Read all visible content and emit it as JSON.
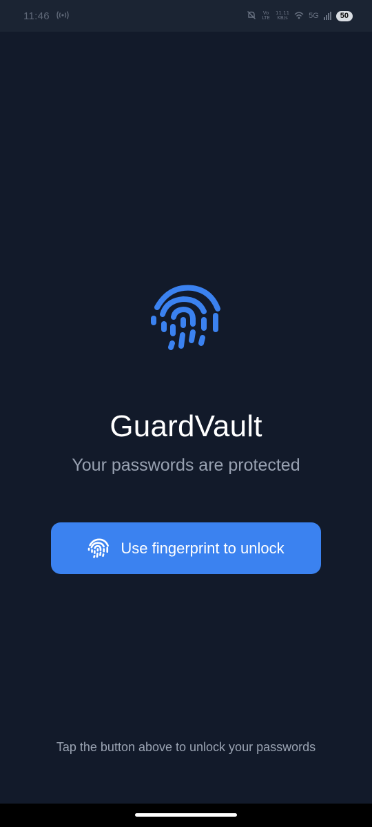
{
  "status_bar": {
    "time": "11:46",
    "volte": "Vo LTE",
    "speed_value": "11.11",
    "speed_unit": "KB/s",
    "network": "5G",
    "battery": "50"
  },
  "app": {
    "name": "GuardVault",
    "subtitle": "Your passwords are protected",
    "accent_color": "#3b82f0",
    "background_color": "#121a2a",
    "logo_icon": "fingerprint-icon"
  },
  "unlock_button": {
    "label": "Use fingerprint to unlock",
    "icon": "fingerprint-icon"
  },
  "hint": "Tap the button above to unlock your passwords"
}
